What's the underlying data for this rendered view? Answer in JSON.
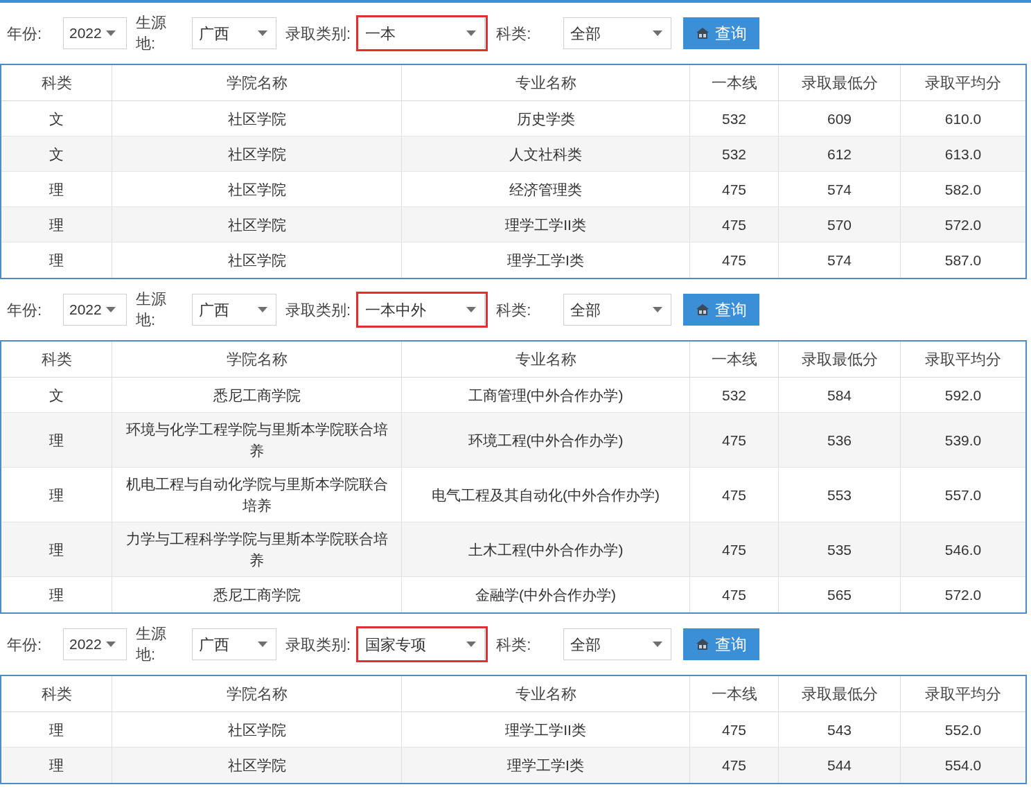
{
  "panels": [
    {
      "filters": {
        "year_label": "年份:",
        "year": "2022",
        "origin_label": "生源地:",
        "origin": "广西",
        "category_label": "录取类别:",
        "category": "一本",
        "category_highlighted": true,
        "subject_label": "科类:",
        "subject": "全部",
        "button": "查询"
      },
      "columns": [
        "科类",
        "学院名称",
        "专业名称",
        "一本线",
        "录取最低分",
        "录取平均分"
      ],
      "rows": [
        [
          "文",
          "社区学院",
          "历史学类",
          "532",
          "609",
          "610.0"
        ],
        [
          "文",
          "社区学院",
          "人文社科类",
          "532",
          "612",
          "613.0"
        ],
        [
          "理",
          "社区学院",
          "经济管理类",
          "475",
          "574",
          "582.0"
        ],
        [
          "理",
          "社区学院",
          "理学工学II类",
          "475",
          "570",
          "572.0"
        ],
        [
          "理",
          "社区学院",
          "理学工学I类",
          "475",
          "574",
          "587.0"
        ]
      ]
    },
    {
      "filters": {
        "year_label": "年份:",
        "year": "2022",
        "origin_label": "生源地:",
        "origin": "广西",
        "category_label": "录取类别:",
        "category": "一本中外",
        "category_highlighted": true,
        "subject_label": "科类:",
        "subject": "全部",
        "button": "查询"
      },
      "columns": [
        "科类",
        "学院名称",
        "专业名称",
        "一本线",
        "录取最低分",
        "录取平均分"
      ],
      "rows": [
        [
          "文",
          "悉尼工商学院",
          "工商管理(中外合作办学)",
          "532",
          "584",
          "592.0"
        ],
        [
          "理",
          "环境与化学工程学院与里斯本学院联合培养",
          "环境工程(中外合作办学)",
          "475",
          "536",
          "539.0"
        ],
        [
          "理",
          "机电工程与自动化学院与里斯本学院联合培养",
          "电气工程及其自动化(中外合作办学)",
          "475",
          "553",
          "557.0"
        ],
        [
          "理",
          "力学与工程科学学院与里斯本学院联合培养",
          "土木工程(中外合作办学)",
          "475",
          "535",
          "546.0"
        ],
        [
          "理",
          "悉尼工商学院",
          "金融学(中外合作办学)",
          "475",
          "565",
          "572.0"
        ]
      ]
    },
    {
      "filters": {
        "year_label": "年份:",
        "year": "2022",
        "origin_label": "生源地:",
        "origin": "广西",
        "category_label": "录取类别:",
        "category": "国家专项",
        "category_highlighted": true,
        "subject_label": "科类:",
        "subject": "全部",
        "button": "查询"
      },
      "columns": [
        "科类",
        "学院名称",
        "专业名称",
        "一本线",
        "录取最低分",
        "录取平均分"
      ],
      "rows": [
        [
          "理",
          "社区学院",
          "理学工学II类",
          "475",
          "543",
          "552.0"
        ],
        [
          "理",
          "社区学院",
          "理学工学I类",
          "475",
          "544",
          "554.0"
        ]
      ]
    }
  ]
}
